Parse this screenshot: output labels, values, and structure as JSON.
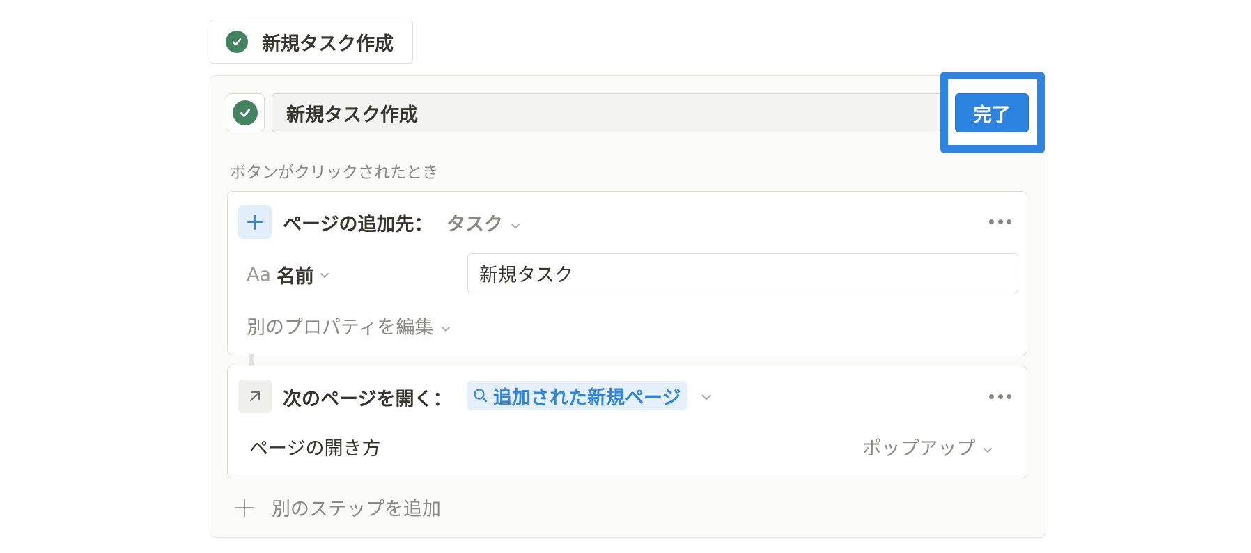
{
  "top_button": {
    "label": "新規タスク作成",
    "icon": "check-circle-icon"
  },
  "editor": {
    "name_value": "新規タスク作成",
    "done_label": "完了",
    "trigger_caption": "ボタンがクリックされたとき"
  },
  "step1": {
    "title": "ページの追加先：",
    "target": "タスク",
    "property_label": "名前",
    "property_type_icon": "Aa",
    "property_value": "新規タスク",
    "edit_other_props": "別のプロパティを編集"
  },
  "step2": {
    "title": "次のページを開く：",
    "page": "追加された新規ページ",
    "open_mode_label": "ページの開き方",
    "open_mode_value": "ポップアップ"
  },
  "add_step_label": "別のステップを追加",
  "colors": {
    "accent_blue": "#2e84e0",
    "check_green": "#448361",
    "highlight_frame": "#2e84e0"
  }
}
